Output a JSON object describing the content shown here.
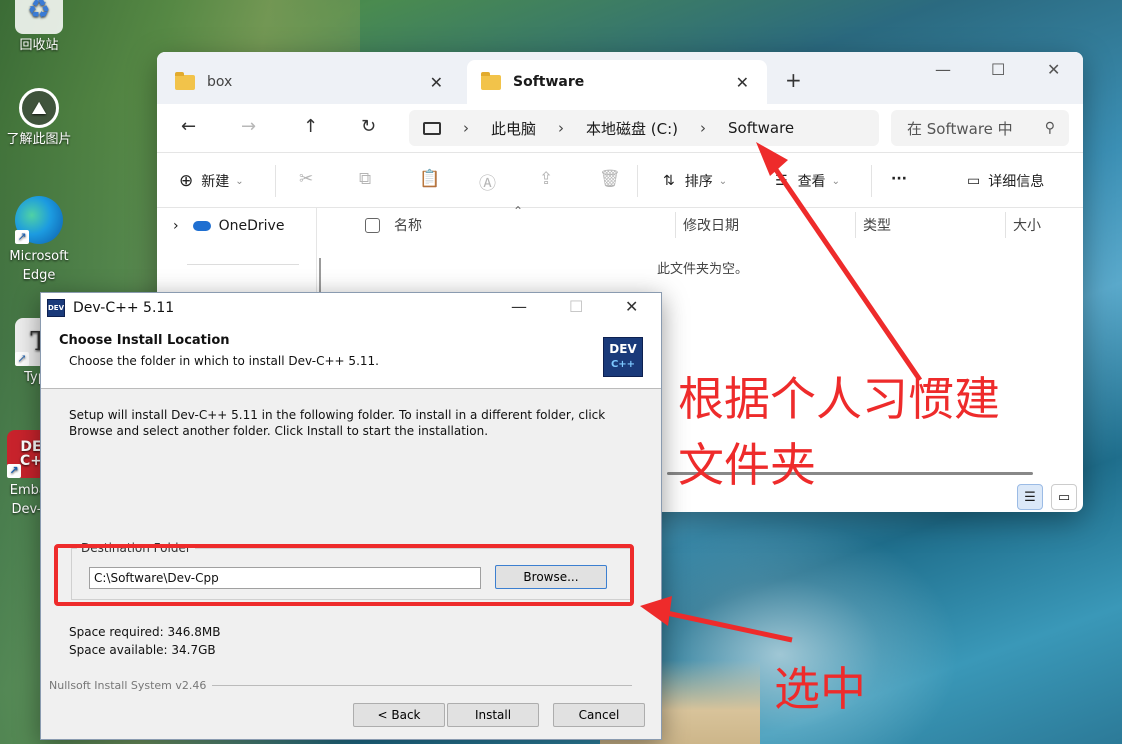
{
  "desktop": {
    "icons": [
      {
        "id": "recycle",
        "label": "回收站"
      },
      {
        "id": "learn",
        "label": "了解此图片"
      },
      {
        "id": "edge",
        "label": "Microsoft\nEdge"
      },
      {
        "id": "typora",
        "label": "Typo"
      },
      {
        "id": "embarcadero",
        "label": "Embar\nDev-C"
      }
    ]
  },
  "explorer": {
    "tabs": [
      {
        "label": "box",
        "active": false
      },
      {
        "label": "Software",
        "active": true
      }
    ],
    "address": {
      "segments": [
        "此电脑",
        "本地磁盘 (C:)",
        "Software"
      ]
    },
    "search_placeholder": "在 Software 中",
    "commands": {
      "new": "新建",
      "sort": "排序",
      "view": "查看",
      "more": "···",
      "details": "详细信息"
    },
    "columns": [
      "名称",
      "修改日期",
      "类型",
      "大小"
    ],
    "nav": {
      "onedrive": "OneDrive"
    },
    "empty_text": "此文件夹为空。"
  },
  "installer": {
    "title": "Dev-C++ 5.11",
    "heading": "Choose Install Location",
    "subheading": "Choose the folder in which to install Dev-C++ 5.11.",
    "description": "Setup will install Dev-C++ 5.11 in the following folder. To install in a different folder, click Browse and select another folder. Click Install to start the installation.",
    "group_label": "Destination Folder",
    "path_value": "C:\\Software\\Dev-Cpp",
    "browse_label": "Browse...",
    "space_required": "Space required: 346.8MB",
    "space_available": "Space available: 34.7GB",
    "branding": "Nullsoft Install System v2.46",
    "buttons": {
      "back": "< Back",
      "install": "Install",
      "cancel": "Cancel"
    },
    "logo_text": "DEV",
    "logo_sub": "C++"
  },
  "annotations": {
    "folder_note_line1": "根据个人习惯建",
    "folder_note_line2": "文件夹",
    "select_note": "选中",
    "color": "#ee2b2b"
  }
}
